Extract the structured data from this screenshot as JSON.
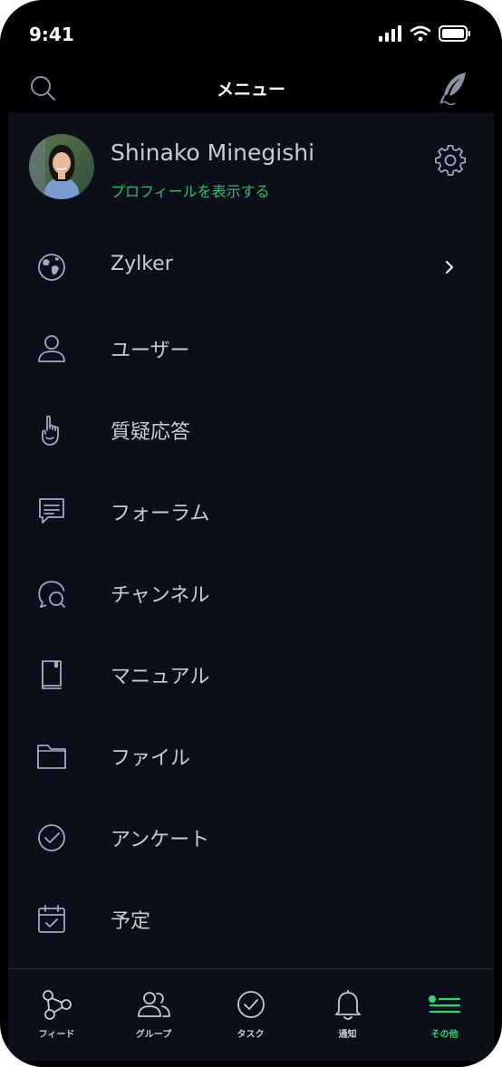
{
  "status_bar": {
    "time": "9:41"
  },
  "header": {
    "title": "メニュー"
  },
  "profile": {
    "name": "Shinako Minegishi",
    "link": "プロフィールを表示する"
  },
  "menu": {
    "items": [
      {
        "label": "Zylker",
        "icon": "globe-icon",
        "has_chevron": true
      },
      {
        "label": "ユーザー",
        "icon": "user-icon"
      },
      {
        "label": "質疑応答",
        "icon": "raised-hand-icon"
      },
      {
        "label": "フォーラム",
        "icon": "forum-icon"
      },
      {
        "label": "チャンネル",
        "icon": "channel-icon"
      },
      {
        "label": "マニュアル",
        "icon": "manual-icon"
      },
      {
        "label": "ファイル",
        "icon": "folder-icon"
      },
      {
        "label": "アンケート",
        "icon": "poll-icon"
      },
      {
        "label": "予定",
        "icon": "calendar-icon"
      }
    ]
  },
  "tabbar": {
    "tabs": [
      {
        "label": "フィード",
        "icon": "feed-icon"
      },
      {
        "label": "グループ",
        "icon": "groups-icon"
      },
      {
        "label": "タスク",
        "icon": "task-icon"
      },
      {
        "label": "通知",
        "icon": "bell-icon"
      },
      {
        "label": "その他",
        "icon": "more-menu-icon",
        "active": true
      }
    ]
  },
  "colors": {
    "background": "#0a0f1a",
    "text": "#c7cbd6",
    "accent_green": "#2ed573",
    "link_green": "#2dbf6e"
  }
}
